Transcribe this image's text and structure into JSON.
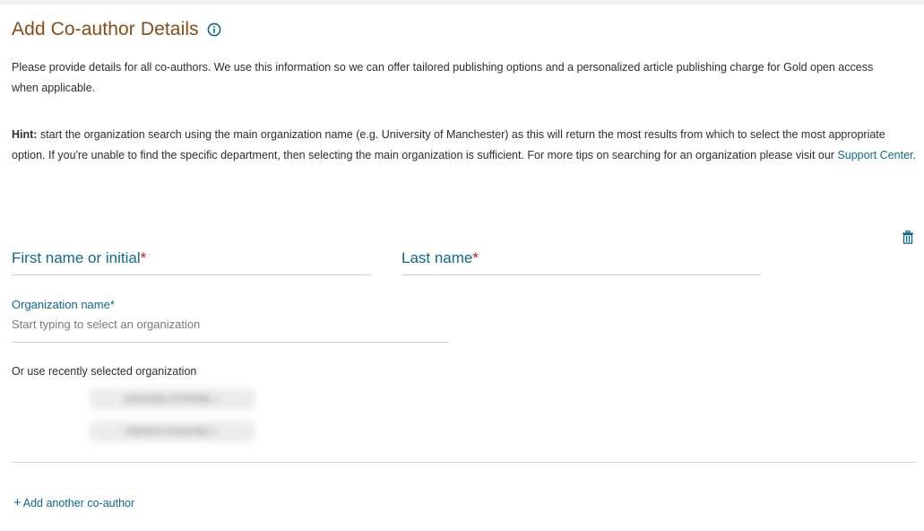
{
  "header": {
    "title": "Add Co-author Details",
    "info_icon": "info-circle-icon"
  },
  "intro": {
    "text": "Please provide details for all co-authors. We use this information so we can offer tailored publishing options and a personalized article publishing charge for Gold open access when applicable."
  },
  "hint": {
    "label": "Hint:",
    "text": " start the organization search using the main organization name (e.g. University of Manchester) as this will return the most results from which to select the most appropriate option. If you're unable to find the specific department, then selecting the main organization is sufficient. For more tips on searching for an organization please visit our ",
    "link_text": "Support Center",
    "suffix": "."
  },
  "author_form": {
    "delete_icon": "trash-icon",
    "first_name": {
      "label": "First name or initial",
      "required_mark": "*"
    },
    "last_name": {
      "label": "Last name",
      "required_mark": "*"
    },
    "organization": {
      "label": "Organization name",
      "required_mark": "*",
      "placeholder": "Start typing to select an organization",
      "value": ""
    },
    "recent": {
      "label": "Or use recently selected organization",
      "items": [
        "University of Florida ✓",
        "Stanford University ✓"
      ]
    }
  },
  "actions": {
    "add_coauthor_icon": "plus-icon",
    "add_coauthor_label": "Add another co-author"
  },
  "colors": {
    "heading": "#8a4b16",
    "accent": "#0c6a8b",
    "required": "#c8102e"
  }
}
